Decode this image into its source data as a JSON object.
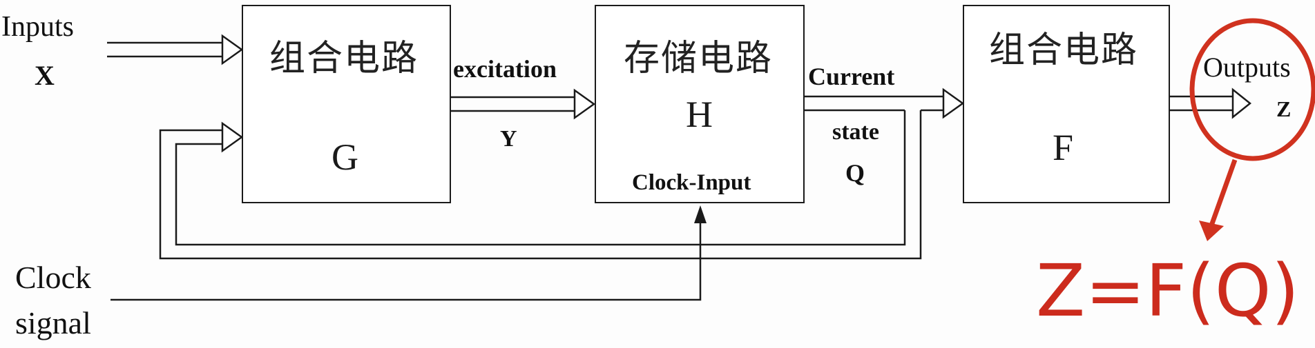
{
  "labels": {
    "inputs": "Inputs",
    "x": "X",
    "excitation": "excitation",
    "y": "Y",
    "current": "Current",
    "state": "state",
    "q": "Q",
    "outputs": "Outputs",
    "z": "Z",
    "clock": "Clock",
    "signal": "signal"
  },
  "blocks": {
    "g": {
      "title": "组合电路",
      "letter": "G"
    },
    "h": {
      "title": "存储电路",
      "letter": "H",
      "clock_input": "Clock-Input"
    },
    "f": {
      "title": "组合电路",
      "letter": "F"
    }
  },
  "annotation": {
    "formula": "Z=F(Q)",
    "color": "#cc2b1d"
  }
}
